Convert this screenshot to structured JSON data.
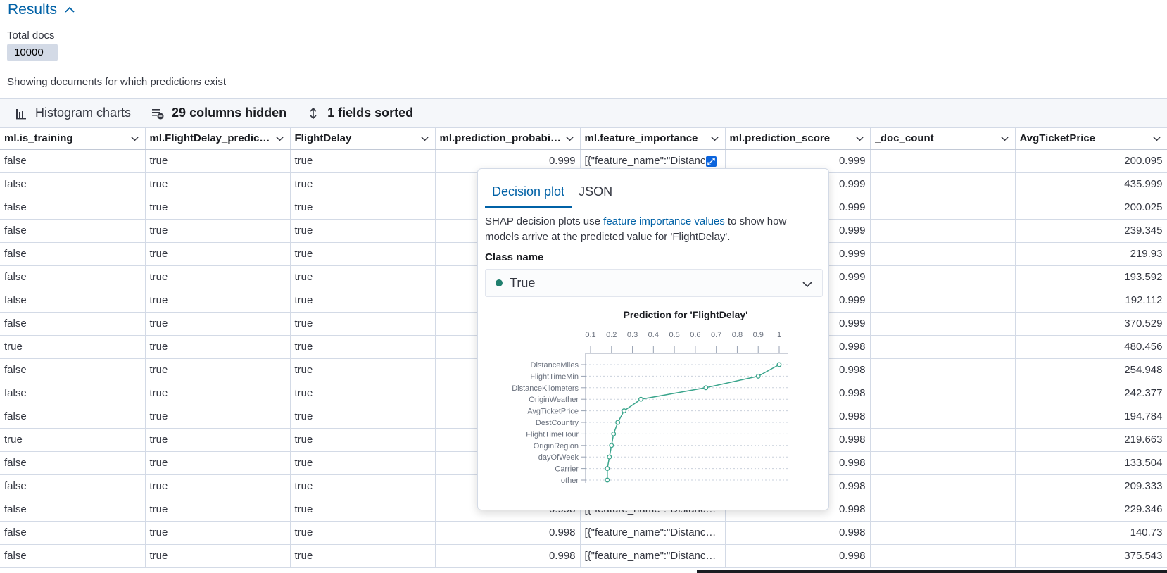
{
  "results": {
    "title": "Results",
    "total_label": "Total docs",
    "total_value": "10000",
    "showing_text": "Showing documents for which predictions exist"
  },
  "toolbar": {
    "histogram": "Histogram charts",
    "columns_hidden": "29 columns hidden",
    "fields_sorted": "1 fields sorted"
  },
  "columns": [
    "ml.is_training",
    "ml.FlightDelay_prediction",
    "FlightDelay",
    "ml.prediction_probability",
    "ml.feature_importance",
    "ml.prediction_score",
    "_doc_count",
    "AvgTicketPrice"
  ],
  "rows": [
    [
      "false",
      "true",
      "true",
      "0.999",
      "[{\"feature_name\":\"DistanceMiles\"",
      "0.999",
      "",
      "200.095"
    ],
    [
      "false",
      "true",
      "true",
      "",
      "",
      "0.999",
      "",
      "435.999"
    ],
    [
      "false",
      "true",
      "true",
      "",
      "",
      "0.999",
      "",
      "200.025"
    ],
    [
      "false",
      "true",
      "true",
      "",
      "",
      "0.999",
      "",
      "239.345"
    ],
    [
      "false",
      "true",
      "true",
      "",
      "",
      "0.999",
      "",
      "219.93"
    ],
    [
      "false",
      "true",
      "true",
      "",
      "",
      "0.999",
      "",
      "193.592"
    ],
    [
      "false",
      "true",
      "true",
      "",
      "",
      "0.999",
      "",
      "192.112"
    ],
    [
      "false",
      "true",
      "true",
      "",
      "",
      "0.999",
      "",
      "370.529"
    ],
    [
      "true",
      "true",
      "true",
      "",
      "",
      "0.998",
      "",
      "480.456"
    ],
    [
      "false",
      "true",
      "true",
      "",
      "",
      "0.998",
      "",
      "254.948"
    ],
    [
      "false",
      "true",
      "true",
      "",
      "",
      "0.998",
      "",
      "242.377"
    ],
    [
      "false",
      "true",
      "true",
      "",
      "",
      "0.998",
      "",
      "194.784"
    ],
    [
      "true",
      "true",
      "true",
      "",
      "",
      "0.998",
      "",
      "219.663"
    ],
    [
      "false",
      "true",
      "true",
      "",
      "",
      "0.998",
      "",
      "133.504"
    ],
    [
      "false",
      "true",
      "true",
      "",
      "",
      "0.998",
      "",
      "209.333"
    ],
    [
      "false",
      "true",
      "true",
      "0.998",
      "[{\"feature_name\":\"DistanceMiles\"",
      "0.998",
      "",
      "229.346"
    ],
    [
      "false",
      "true",
      "true",
      "0.998",
      "[{\"feature_name\":\"DistanceMiles\"",
      "0.998",
      "",
      "140.73"
    ],
    [
      "false",
      "true",
      "true",
      "0.998",
      "[{\"feature_name\":\"DistanceMiles\"",
      "0.998",
      "",
      "375.543"
    ]
  ],
  "popover": {
    "tabs": [
      "Decision plot",
      "JSON"
    ],
    "desc_pre": "SHAP decision plots use ",
    "desc_link": "feature importance values",
    "desc_post": " to show how models arrive at the predicted value for 'FlightDelay'.",
    "class_label": "Class name",
    "class_value": "True"
  },
  "colors": {
    "accent": "#0061a6",
    "line": "#3aa58c",
    "class_dot": "#207f6e"
  },
  "chart_data": {
    "type": "line",
    "title": "Prediction for 'FlightDelay'",
    "x_ticks": [
      "0.1",
      "0.2",
      "0.3",
      "0.4",
      "0.5",
      "0.6",
      "0.7",
      "0.8",
      "0.9",
      "1"
    ],
    "xlim": [
      0.1,
      1.0
    ],
    "categories": [
      "DistanceMiles",
      "FlightTimeMin",
      "DistanceKilometers",
      "OriginWeather",
      "AvgTicketPrice",
      "DestCountry",
      "FlightTimeHour",
      "OriginRegion",
      "dayOfWeek",
      "Carrier",
      "other"
    ],
    "values": [
      1.0,
      0.9,
      0.65,
      0.34,
      0.26,
      0.23,
      0.21,
      0.2,
      0.19,
      0.18,
      0.18
    ],
    "grid": "horizontal-dotted"
  }
}
